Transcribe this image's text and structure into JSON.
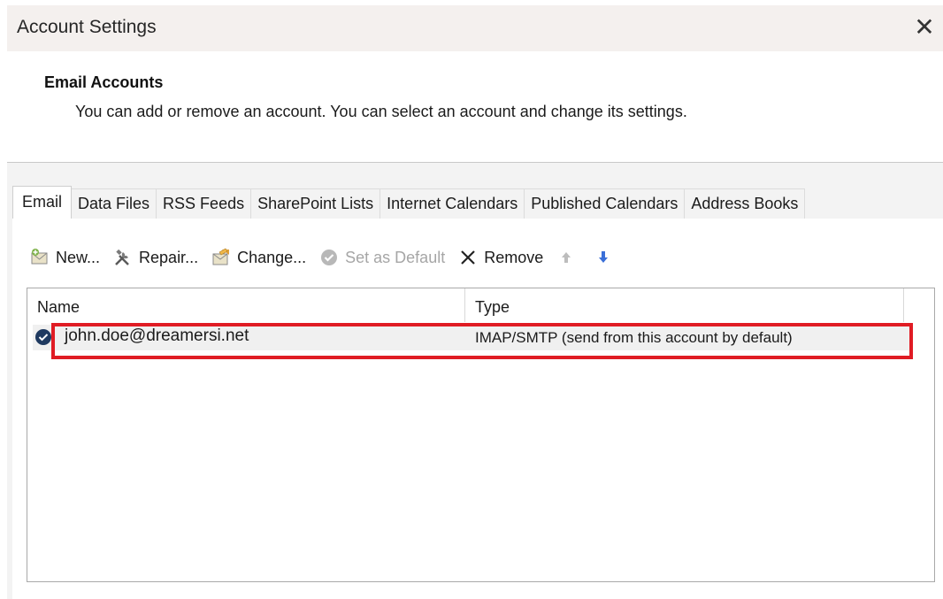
{
  "window": {
    "title": "Account Settings",
    "close_icon": "close-icon"
  },
  "header": {
    "section_title": "Email Accounts",
    "description": "You can add or remove an account. You can select an account and change its settings."
  },
  "tabs": [
    {
      "label": "Email",
      "active": true
    },
    {
      "label": "Data Files",
      "active": false
    },
    {
      "label": "RSS Feeds",
      "active": false
    },
    {
      "label": "SharePoint Lists",
      "active": false
    },
    {
      "label": "Internet Calendars",
      "active": false
    },
    {
      "label": "Published Calendars",
      "active": false
    },
    {
      "label": "Address Books",
      "active": false
    }
  ],
  "toolbar": {
    "new_label": "New...",
    "repair_label": "Repair...",
    "change_label": "Change...",
    "set_default_label": "Set as Default",
    "remove_label": "Remove"
  },
  "list": {
    "columns": {
      "name": "Name",
      "type": "Type"
    },
    "rows": [
      {
        "name": "john.doe@dreamersi.net",
        "type": "IMAP/SMTP (send from this account by default)",
        "default": true
      }
    ]
  },
  "colors": {
    "highlight": "#e01c24",
    "check": "#1f3a60",
    "arrow": "#3a6fd8"
  }
}
